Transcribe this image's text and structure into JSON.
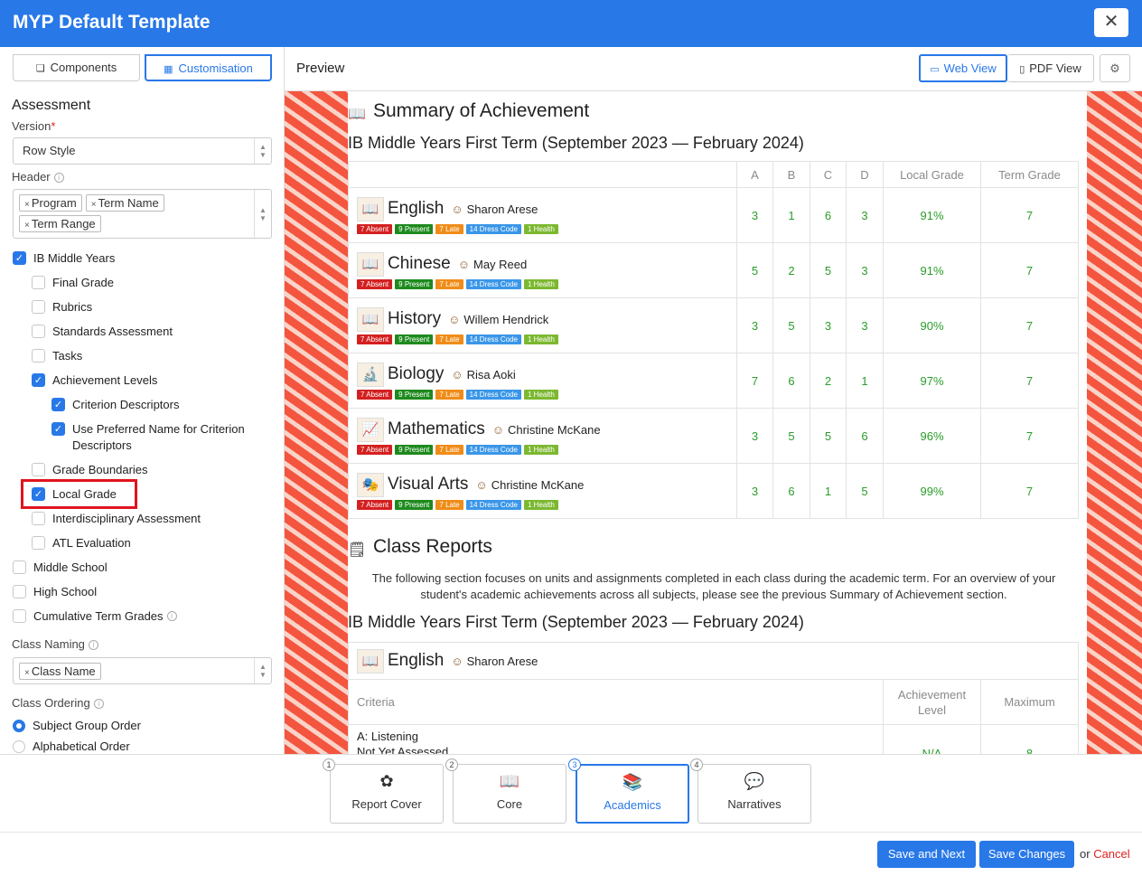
{
  "window": {
    "title": "MYP Default Template",
    "close": "✕"
  },
  "left_tabs": {
    "components": "Components",
    "customisation": "Customisation"
  },
  "assessment": {
    "title": "Assessment",
    "version_label": "Version",
    "version_required": "*",
    "version_value": "Row Style",
    "header_label": "Header",
    "header_chips": [
      "Program",
      "Term Name",
      "Term Range"
    ],
    "checkboxes": [
      {
        "label": "IB Middle Years",
        "checked": true
      },
      {
        "label": "Final Grade",
        "checked": false
      },
      {
        "label": "Rubrics",
        "checked": false
      },
      {
        "label": "Standards Assessment",
        "checked": false
      },
      {
        "label": "Tasks",
        "checked": false
      },
      {
        "label": "Achievement Levels",
        "checked": true
      },
      {
        "label": "Criterion Descriptors",
        "checked": true
      },
      {
        "label": "Use Preferred Name for Criterion Descriptors",
        "checked": true
      },
      {
        "label": "Grade Boundaries",
        "checked": false
      },
      {
        "label": "Local Grade",
        "checked": true
      },
      {
        "label": "Interdisciplinary Assessment",
        "checked": false
      },
      {
        "label": "ATL Evaluation",
        "checked": false
      },
      {
        "label": "Middle School",
        "checked": false
      },
      {
        "label": "High School",
        "checked": false
      },
      {
        "label": "Cumulative Term Grades",
        "checked": false
      }
    ],
    "class_naming_label": "Class Naming",
    "class_naming_chip": "Class Name",
    "class_ordering_label": "Class Ordering",
    "ordering_options": [
      {
        "label": "Subject Group Order",
        "selected": true
      },
      {
        "label": "Alphabetical Order",
        "selected": false
      }
    ]
  },
  "preview": {
    "title": "Preview",
    "web_view": "Web View",
    "pdf_view": "PDF View",
    "summary_title": "Summary of Achievement",
    "term_title": "IB Middle Years First Term (September 2023 — February 2024)",
    "columns": [
      "A",
      "B",
      "C",
      "D",
      "Local Grade",
      "Term Grade"
    ],
    "badges": [
      "7 Absent",
      "9 Present",
      "7 Late",
      "14 Dress Code",
      "1 Health"
    ],
    "subjects": [
      {
        "name": "English",
        "teacher": "Sharon Arese",
        "icon": "book-icon",
        "a": "3",
        "b": "1",
        "c": "6",
        "d": "3",
        "local": "91%",
        "term": "7"
      },
      {
        "name": "Chinese",
        "teacher": "May Reed",
        "icon": "book-icon",
        "a": "5",
        "b": "2",
        "c": "5",
        "d": "3",
        "local": "91%",
        "term": "7"
      },
      {
        "name": "History",
        "teacher": "Willem Hendrick",
        "icon": "book-icon",
        "a": "3",
        "b": "5",
        "c": "3",
        "d": "3",
        "local": "90%",
        "term": "7"
      },
      {
        "name": "Biology",
        "teacher": "Risa Aoki",
        "icon": "microscope-icon",
        "a": "7",
        "b": "6",
        "c": "2",
        "d": "1",
        "local": "97%",
        "term": "7"
      },
      {
        "name": "Mathematics",
        "teacher": "Christine McKane",
        "icon": "graph-icon",
        "a": "3",
        "b": "5",
        "c": "5",
        "d": "6",
        "local": "96%",
        "term": "7"
      },
      {
        "name": "Visual Arts",
        "teacher": "Christine McKane",
        "icon": "theater-icon",
        "a": "3",
        "b": "6",
        "c": "1",
        "d": "5",
        "local": "99%",
        "term": "7"
      }
    ],
    "class_reports_title": "Class Reports",
    "class_reports_text": "The following section focuses on units and assignments completed in each class during the academic term. For an overview of your student's academic achievements across all subjects, please see the previous Summary of Achievement section.",
    "term_title_2": "IB Middle Years First Term (September 2023 — February 2024)",
    "class_subject": "English",
    "class_teacher": "Sharon Arese",
    "criteria_header": "Criteria",
    "achievement_header": "Achievement Level",
    "maximum_header": "Maximum",
    "criteria_name": "A: Listening",
    "criteria_status": "Not Yet Assessed",
    "criteria_level": "N/A",
    "criteria_max": "8"
  },
  "steps": [
    {
      "num": "1",
      "label": "Report Cover",
      "icon": "flower-icon"
    },
    {
      "num": "2",
      "label": "Core",
      "icon": "book-icon"
    },
    {
      "num": "3",
      "label": "Academics",
      "icon": "books-icon"
    },
    {
      "num": "4",
      "label": "Narratives",
      "icon": "speech-icon"
    }
  ],
  "footer": {
    "save_next": "Save and Next",
    "save_changes": "Save Changes",
    "or": "or",
    "cancel": "Cancel"
  },
  "colors": {
    "primary": "#2878e8",
    "green": "#2a9d2a",
    "pattern": "#f4553f"
  }
}
